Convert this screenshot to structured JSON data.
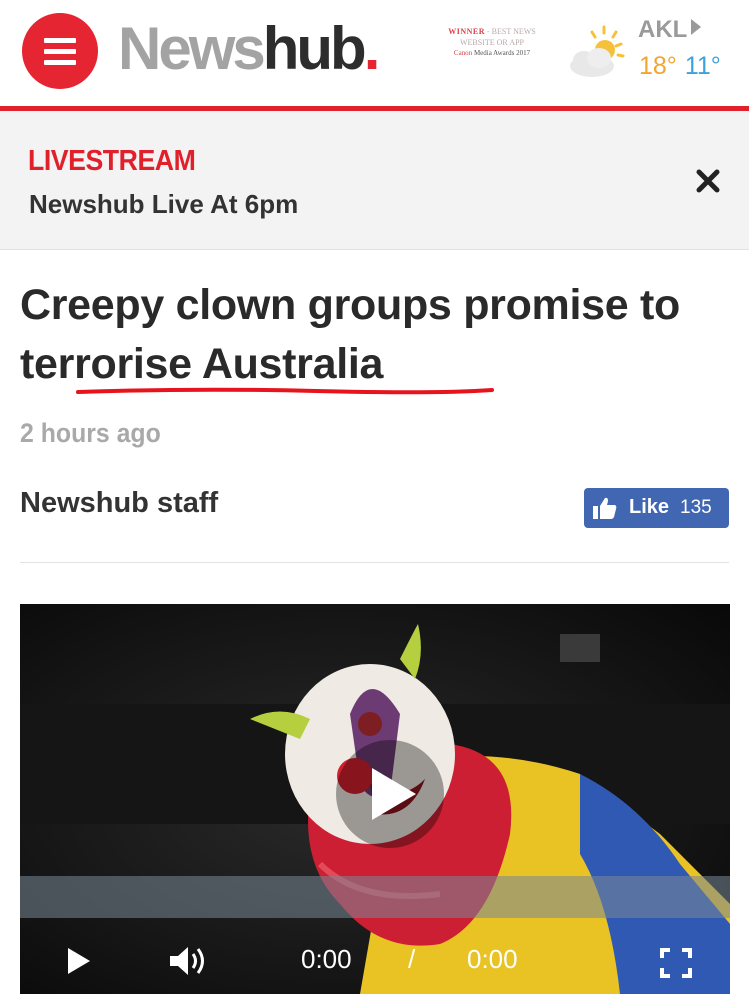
{
  "header": {
    "logo": {
      "news": "News",
      "hub": "hub",
      "dot": "."
    },
    "award": {
      "line1_winner": "WINNER",
      "line1_rest": "- BEST NEWS",
      "line2": "WEBSITE OR APP",
      "line3_brand": "Canon",
      "line3_rest": "Media Awards 2017"
    },
    "weather": {
      "city": "AKL",
      "high": "18°",
      "low": "11°",
      "icon": "partly-sunny-icon"
    }
  },
  "livestream": {
    "label": "LIVESTREAM",
    "title": "Newshub Live At 6pm",
    "close_icon": "close-icon"
  },
  "article": {
    "headline": "Creepy clown groups promise to terrorise Australia",
    "timestamp": "2 hours ago",
    "author": "Newshub staff"
  },
  "like_button": {
    "label": "Like",
    "count": "135",
    "icon": "thumbs-up-icon"
  },
  "video": {
    "current_time": "0:00",
    "separator": "/",
    "duration": "0:00",
    "icons": [
      "play-icon",
      "volume-icon",
      "fullscreen-icon"
    ]
  },
  "colors": {
    "brand_red": "#e52531",
    "facebook_blue": "#4267b2",
    "temp_high": "#f2a52f",
    "temp_low": "#3ca2dc"
  }
}
